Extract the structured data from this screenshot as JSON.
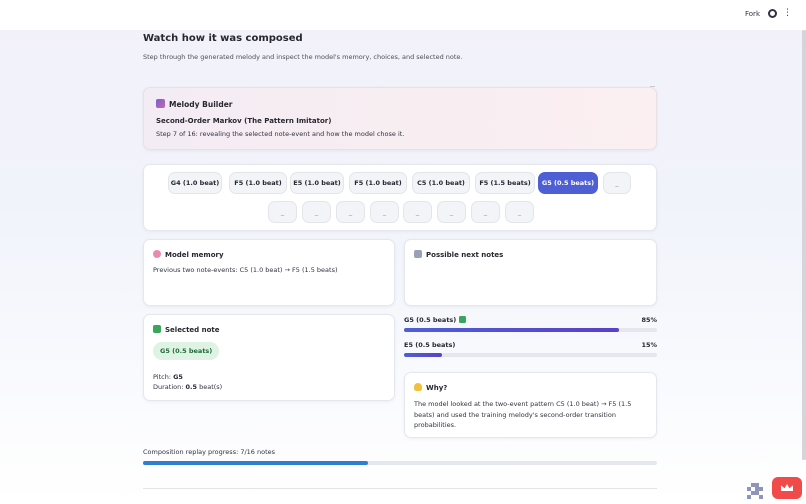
{
  "topbar": {
    "fork_label": "Fork",
    "icons": [
      "github-icon",
      "more-menu-icon"
    ]
  },
  "header": {
    "title": "Watch how it was composed",
    "subtitle": "Step through the generated melody and inspect the model's memory, choices, and selected note."
  },
  "builder": {
    "title": "Melody Builder",
    "model": "Second-Order Markov (The Pattern Imitator)",
    "step": "Step 7 of 16: revealing the selected note-event and how the model chose it."
  },
  "melody": {
    "revealed": [
      "G4 (1.0 beat)",
      "F5 (1.0 beat)",
      "E5 (1.0 beat)",
      "F5 (1.0 beat)",
      "C5 (1.0 beat)",
      "F5 (1.5 beats)",
      "G5 (0.5 beats)"
    ],
    "active_index": 6,
    "placeholder": "_",
    "placeholder_count": 9
  },
  "memory": {
    "title": "Model memory",
    "text": "Previous two note-events: C5 (1.0 beat) → F5 (1.5 beats)"
  },
  "possible": {
    "title": "Possible next notes",
    "options": [
      {
        "label": "G5 (0.5 beats)",
        "selected": true,
        "percent_label": "85%",
        "value": 0.85
      },
      {
        "label": "E5 (0.5 beats)",
        "selected": false,
        "percent_label": "15%",
        "value": 0.15
      }
    ]
  },
  "selected": {
    "title": "Selected note",
    "badge": "G5 (0.5 beats)",
    "pitch_label": "Pitch: ",
    "pitch": "G5",
    "duration_label": "Duration: ",
    "duration_value": "0.5",
    "duration_unit": " beat(s)"
  },
  "why": {
    "title": "Why?",
    "text": "The model looked at the two-event pattern C5 (1.0 beat) → F5 (1.5 beats) and used the training melody's second-order transition probabilities."
  },
  "progress": {
    "label": "Composition replay progress: 7/16 notes",
    "value": 0.4375
  },
  "colors": {
    "accent": "#4e5fd6",
    "progress": "#2f7fd0",
    "success": "#3aa55b",
    "deploy": "#f04a4a"
  }
}
